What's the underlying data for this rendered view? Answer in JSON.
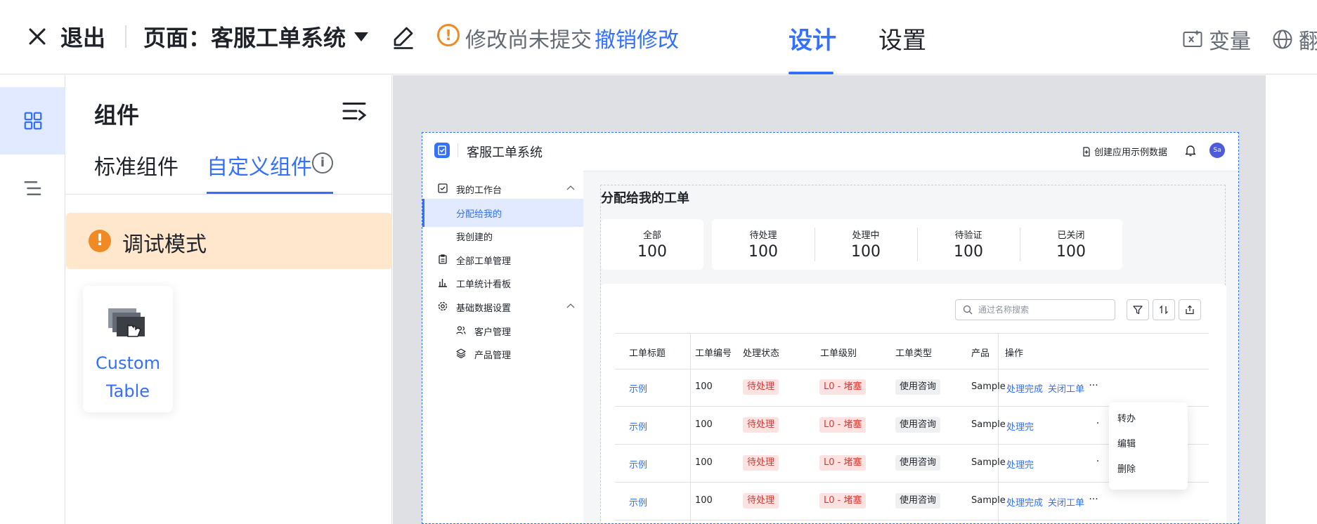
{
  "topbar": {
    "exit_label": "退出",
    "page_label": "页面：客服工单系统",
    "unsaved_text": "修改尚未提交",
    "revert_label": "撤销修改",
    "tabs": [
      {
        "label": "设计"
      },
      {
        "label": "设置"
      }
    ],
    "variables_label": "变量",
    "language_label": "翻"
  },
  "panel": {
    "title": "组件",
    "tabs": [
      {
        "label": "标准组件"
      },
      {
        "label": "自定义组件"
      }
    ],
    "debug_label": "调试模式",
    "components": [
      {
        "label": "Custom Table"
      }
    ]
  },
  "app": {
    "title": "客服工单系统",
    "create_label": "创建应用示例数据",
    "avatar": "Sa",
    "nav": [
      {
        "label": "我的工作台"
      },
      {
        "label": "分配给我的"
      },
      {
        "label": "我创建的"
      },
      {
        "label": "全部工单管理"
      },
      {
        "label": "工单统计看板"
      },
      {
        "label": "基础数据设置"
      },
      {
        "label": "客户管理"
      },
      {
        "label": "产品管理"
      }
    ],
    "main_title": "分配给我的工单",
    "stats": [
      {
        "label": "全部",
        "value": "100"
      },
      {
        "label": "待处理",
        "value": "100"
      },
      {
        "label": "处理中",
        "value": "100"
      },
      {
        "label": "待验证",
        "value": "100"
      },
      {
        "label": "已关闭",
        "value": "100"
      }
    ],
    "search_placeholder": "通过名称搜索",
    "columns": [
      "工单标题",
      "工单编号",
      "处理状态",
      "工单级别",
      "工单类型",
      "产品",
      "操作"
    ],
    "rows": [
      {
        "title": "示例",
        "number": "100",
        "status": "待处理",
        "level": "L0 - 堵塞",
        "type": "使用咨询",
        "product": "Sample",
        "action1": "处理完成",
        "action2": "关闭工单",
        "more": "···"
      },
      {
        "title": "示例",
        "number": "100",
        "status": "待处理",
        "level": "L0 - 堵塞",
        "type": "使用咨询",
        "product": "Sample",
        "action1": "处理完",
        "action2": "",
        "more": "·"
      },
      {
        "title": "示例",
        "number": "100",
        "status": "待处理",
        "level": "L0 - 堵塞",
        "type": "使用咨询",
        "product": "Sample",
        "action1": "处理完",
        "action2": "",
        "more": "·"
      },
      {
        "title": "示例",
        "number": "100",
        "status": "待处理",
        "level": "L0 - 堵塞",
        "type": "使用咨询",
        "product": "Sample",
        "action1": "处理完成",
        "action2": "关闭工单",
        "more": "···"
      }
    ],
    "dropdown": [
      "转办",
      "编辑",
      "删除"
    ]
  },
  "colors": {
    "accent": "#3370ff",
    "warning": "#f08a24",
    "debug_bg": "#fee7cd",
    "canvas_bg": "#dee0e3",
    "tag_red_bg": "#fde2e2",
    "tag_red_fg": "#d83931"
  }
}
